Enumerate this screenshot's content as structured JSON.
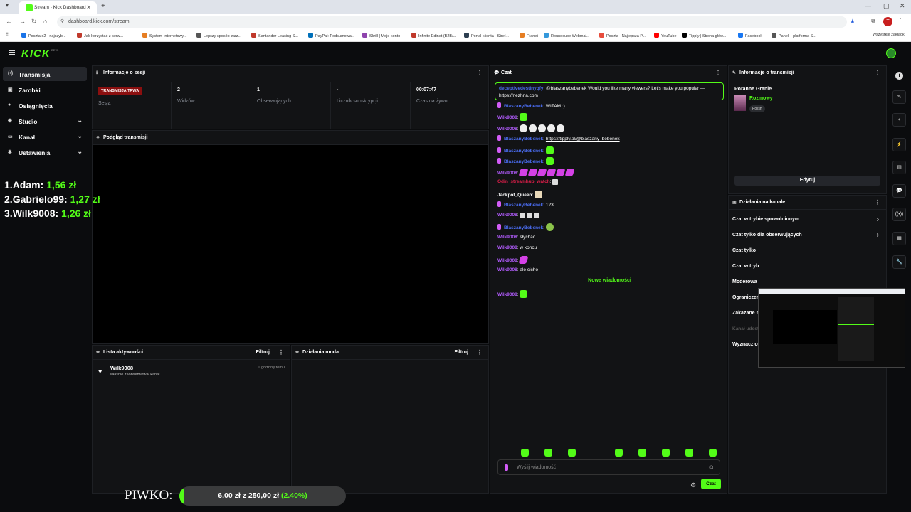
{
  "browser": {
    "tab_title": "Stream - Kick Dashboard",
    "url": "dashboard.kick.com/stream",
    "profile_initial": "T",
    "bookmarks": [
      "Poczta o2 - najszyb...",
      "Jak korzystać z serw...",
      "System Internetowy...",
      "Lepszy sposób zarz...",
      "Santander Leasing S...",
      "PayPal: Podsumowa...",
      "Skrill | Moje konto",
      "Infinite Edinet (B2B/...",
      "Portal klienta - Stref...",
      "Franet",
      "Roundcube Webmai...",
      "Poczta - Najlepsza P...",
      "YouTube",
      "Tipply | Strona głów...",
      "Facebook",
      "Panel – platforma S..."
    ],
    "bookmarks_all": "Wszystkie zakładki"
  },
  "app": {
    "logo": "KICK",
    "logo_badge": "BETA"
  },
  "sidebar": {
    "items": [
      {
        "label": "Transmisja",
        "icon": "broadcast-icon",
        "glyph": "(•)"
      },
      {
        "label": "Zarobki",
        "icon": "wallet-icon",
        "glyph": "▣"
      },
      {
        "label": "Osiągnięcia",
        "icon": "trophy-icon",
        "glyph": "●"
      },
      {
        "label": "Studio",
        "icon": "studio-icon",
        "glyph": "✚"
      },
      {
        "label": "Kanał",
        "icon": "channel-icon",
        "glyph": "▭"
      },
      {
        "label": "Ustawienia",
        "icon": "settings-icon",
        "glyph": "✱"
      }
    ]
  },
  "overlay": {
    "leaderboard": [
      {
        "rank": "1.",
        "name": "Adam:",
        "amount": "1,56 zł"
      },
      {
        "rank": "2.",
        "name": "Gabrielo99:",
        "amount": "1,27 zł"
      },
      {
        "rank": "3.",
        "name": "Wilk9008:",
        "amount": "1,26 zł"
      }
    ],
    "goal_label": "PIWKO:",
    "goal_current": "6,00 zł",
    "goal_sep": "z",
    "goal_target": "250,00 zł",
    "goal_percent_text": "(2.40%)",
    "goal_fraction": 0.024
  },
  "session": {
    "title": "Informacje o sesji",
    "live_badge": "TRANSMISJA TRWA",
    "session_label": "Sesja",
    "stats": [
      {
        "value": "2",
        "label": "Widzów"
      },
      {
        "value": "1",
        "label": "Obserwujących"
      },
      {
        "value": "-",
        "label": "Licznik subskrypcji"
      },
      {
        "value": "00:07:47",
        "label": "Czas na żywo"
      }
    ]
  },
  "preview": {
    "title": "Podgląd transmisji"
  },
  "activity": {
    "title": "Lista aktywności",
    "filter": "Filtruj",
    "items": [
      {
        "name": "Wilk9008",
        "text": "właśnie zaobserwował kanał",
        "time": "1 godzinę temu"
      }
    ]
  },
  "modactions": {
    "title": "Działania moda",
    "filter": "Filtruj"
  },
  "chat": {
    "title": "Czat",
    "pinned_user": "deceptivedestinyqfy",
    "pinned_text": ": @blaszanybebenek Would you like many viewers? Let's make you popular — https://nezhna.com",
    "messages": [
      {
        "user": "BlaszanyBebenek",
        "style": "bl",
        "badge": true,
        "text": ": WITAM :)",
        "emotes": ""
      },
      {
        "user": "Wilk9008",
        "style": "pk",
        "badge": false,
        "text": ":",
        "emotes": "g"
      },
      {
        "user": "Wilk9008",
        "style": "pk",
        "badge": false,
        "text": ":",
        "emotes": "wwwww"
      },
      {
        "user": "BlaszanyBebenek",
        "style": "bl",
        "badge": true,
        "text": ":",
        "link": "https://tipply.pl/@blaszany_bebenek",
        "emotes": ""
      },
      {
        "user": "BlaszanyBebenek",
        "style": "bl",
        "badge": true,
        "text": ":",
        "emotes": "g"
      },
      {
        "user": "BlaszanyBebenek",
        "style": "bl",
        "badge": true,
        "text": ":",
        "emotes": "g"
      },
      {
        "user": "Wilk9008",
        "style": "pk",
        "badge": false,
        "text": ":",
        "emotes": "pppppp"
      },
      {
        "user": "Odin_streamhub_watch",
        "style": "rd",
        "badge": false,
        "text": ":",
        "emotes": "s"
      },
      {
        "user": "Jackpot_Queen",
        "style": "wh",
        "badge": false,
        "text": ":",
        "emotes": "b"
      },
      {
        "user": "BlaszanyBebenek",
        "style": "bl",
        "badge": true,
        "text": ": 123",
        "emotes": ""
      },
      {
        "user": "Wilk9008",
        "style": "pk",
        "badge": false,
        "text": ":",
        "emotes": "sss"
      },
      {
        "user": "BlaszanyBebenek",
        "style": "bl",
        "badge": true,
        "text": ":",
        "emotes": "o"
      },
      {
        "user": "Wilk9008",
        "style": "pk",
        "badge": false,
        "text": ": słychac",
        "emotes": ""
      },
      {
        "user": "Wilk9008",
        "style": "pk",
        "badge": false,
        "text": ": w koncu",
        "emotes": ""
      },
      {
        "user": "Wilk9008",
        "style": "pk",
        "badge": false,
        "text": ":",
        "emotes": "p"
      },
      {
        "user": "Wilk9008",
        "style": "pk",
        "badge": false,
        "text": ": ale cicho",
        "emotes": ""
      }
    ],
    "new_messages_label": "Nowe wiadomości",
    "after_new": [
      {
        "user": "Wilk9008",
        "style": "pk",
        "badge": false,
        "text": ":",
        "emotes": "g"
      }
    ],
    "input_placeholder": "Wyślij wiadomość",
    "send_label": "Czat"
  },
  "stream_info": {
    "title": "Informacje o transmisji",
    "stream_title": "Poranne Granie",
    "category": "Rozmowy",
    "tag": "Polish",
    "edit_label": "Edytuj"
  },
  "channel_actions": {
    "title": "Działania na kanale",
    "items": [
      {
        "label": "Czat w trybie spowolnionym",
        "arrow": true
      },
      {
        "label": "Czat tylko dla obserwujących",
        "arrow": true
      },
      {
        "label": "Czat tylko",
        "arrow": false
      },
      {
        "label": "Czat w tryb",
        "arrow": false
      },
      {
        "label": "Moderowa",
        "arrow": false
      },
      {
        "label": "Ograniczen",
        "arrow": false
      },
      {
        "label": "Zakazane s",
        "arrow": false
      },
      {
        "label": "Kanał udostępniający",
        "arrow": false,
        "dim": true
      },
      {
        "label": "Wyznacz cele, które chcesz osiągnąć",
        "arrow": true
      }
    ]
  },
  "right_rail": [
    "i",
    "✎",
    "⌖",
    "⚡",
    "▤",
    "💬",
    "((•))",
    "▦",
    "🔧"
  ],
  "colors": {
    "accent": "#53fc18",
    "live": "#8b0f0f",
    "username_pink": "#b35cff",
    "username_blue": "#4a6cf0"
  }
}
